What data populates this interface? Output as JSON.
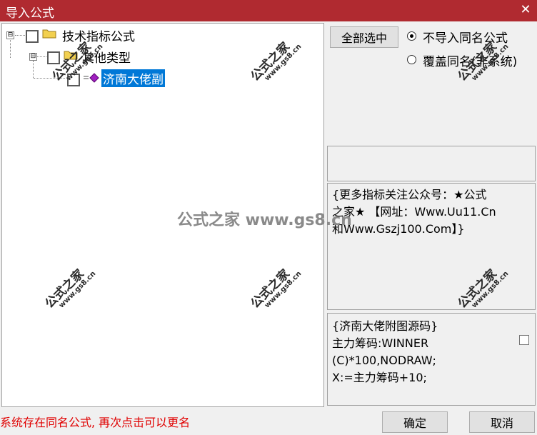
{
  "window": {
    "title": "导入公式",
    "close_glyph": "✕"
  },
  "tree": {
    "expander_open": "⊟",
    "nodes": [
      {
        "label": "技术指标公式"
      },
      {
        "label": "其他类型"
      },
      {
        "label": "济南大佬副"
      }
    ]
  },
  "options": {
    "select_all_label": "全部选中",
    "radio_skip_label": "不导入同名公式",
    "radio_overwrite_label": "覆盖同名(非系统)",
    "selected_radio": "radio_skip"
  },
  "description": {
    "lines": [
      "{更多指标关注公众号：★公式",
      "之家★ 【网址：Www.Uu11.Cn",
      "和Www.Gszj100.Com】}"
    ]
  },
  "code_preview": {
    "lines": [
      "{济南大佬附图源码}",
      "主力筹码:WINNER",
      "(C)*100,NODRAW;",
      "X:=主力筹码+10;"
    ]
  },
  "status_message": "系统存在同名公式, 再次点击可以更名",
  "footer": {
    "ok_label": "确定",
    "cancel_label": "取消"
  },
  "watermark": {
    "small_top": "公式之家",
    "small_bottom": "www.gs8.cn",
    "center": "公式之家 www.gs8.cn"
  }
}
